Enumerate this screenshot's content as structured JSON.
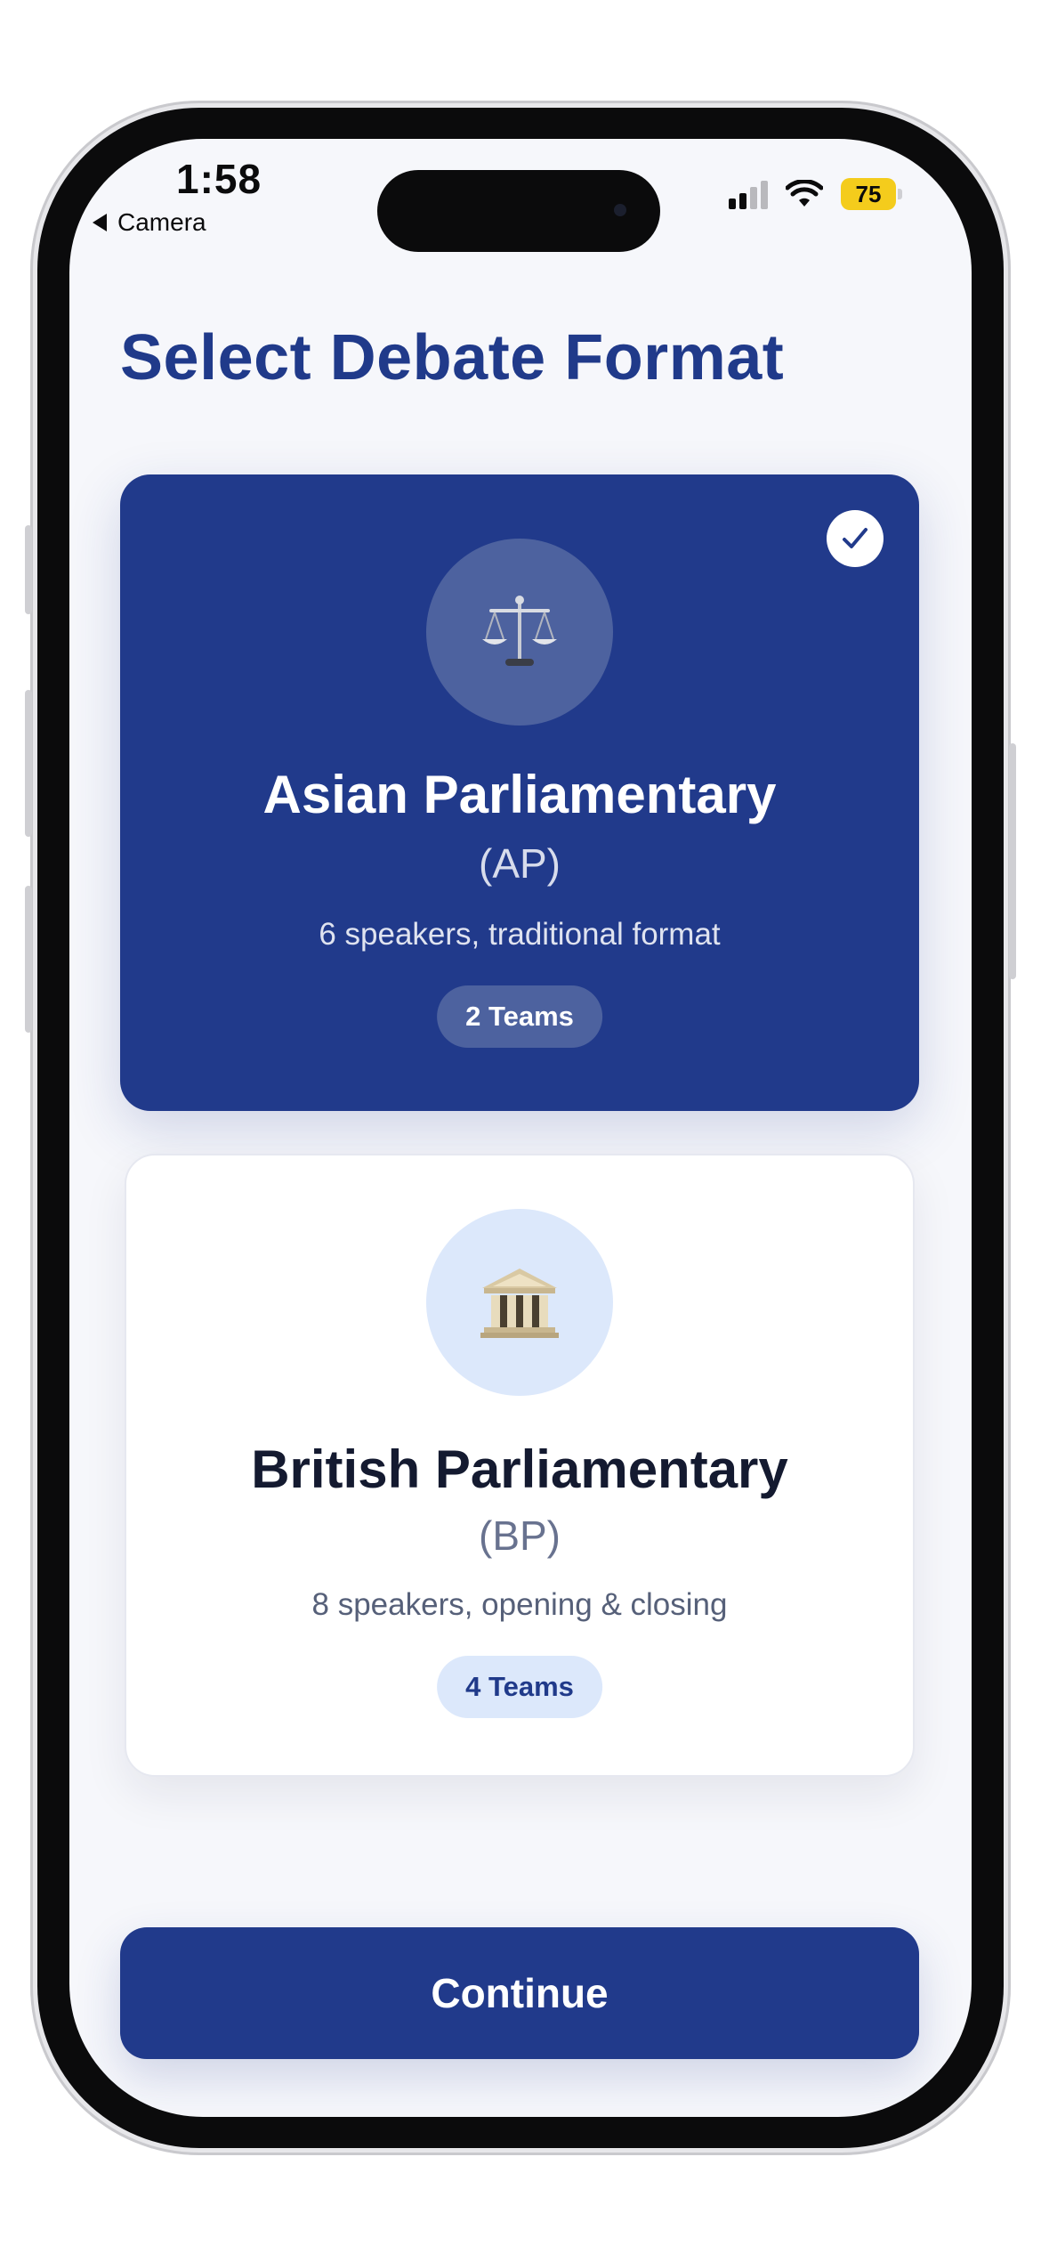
{
  "status_bar": {
    "time": "1:58",
    "back_app": "Camera",
    "battery": "75"
  },
  "page": {
    "title": "Select Debate Format"
  },
  "formats": [
    {
      "title": "Asian Parliamentary",
      "abbr": "(AP)",
      "description": "6 speakers, traditional format",
      "teams": "2 Teams",
      "icon": "scales-icon",
      "selected": true
    },
    {
      "title": "British Parliamentary",
      "abbr": "(BP)",
      "description": "8 speakers, opening & closing",
      "teams": "4 Teams",
      "icon": "classical-building-icon",
      "selected": false
    }
  ],
  "actions": {
    "continue_label": "Continue"
  },
  "colors": {
    "primary": "#213a8b",
    "title": "#203a8a",
    "background": "#f6f7fb",
    "battery": "#f4cc1c"
  }
}
